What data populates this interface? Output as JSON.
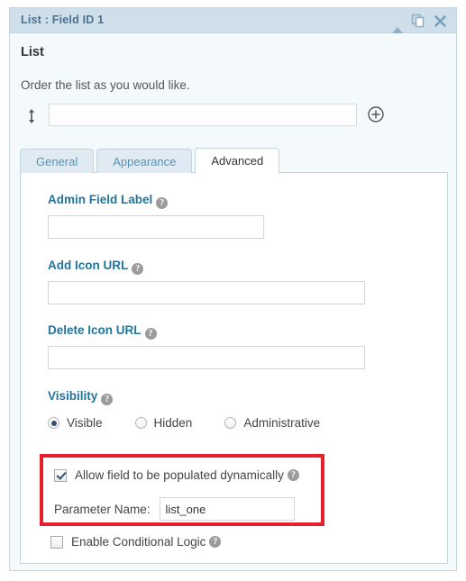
{
  "panel": {
    "title": "List : Field ID 1",
    "header_icons": [
      {
        "name": "collapse-icon",
        "glyph": "▲"
      },
      {
        "name": "duplicate-icon",
        "glyph": "❐"
      },
      {
        "name": "close-icon",
        "glyph": "✕"
      }
    ]
  },
  "field": {
    "name": "List",
    "instruction": "Order the list as you would like.",
    "list_item_value": "",
    "list_item_placeholder": "",
    "drag_handle_icon": "drag-vertical-icon",
    "add_row_icon": "plus-circle-icon"
  },
  "tabs": [
    {
      "label": "General",
      "active": false
    },
    {
      "label": "Appearance",
      "active": false
    },
    {
      "label": "Advanced",
      "active": true
    }
  ],
  "advanced": {
    "admin_field_label": {
      "label": "Admin Field Label",
      "help": "?",
      "value": ""
    },
    "add_icon_url": {
      "label": "Add Icon URL",
      "help": "?",
      "value": ""
    },
    "delete_icon_url": {
      "label": "Delete Icon URL",
      "help": "?",
      "value": ""
    },
    "visibility": {
      "label": "Visibility",
      "help": "?",
      "options": [
        {
          "label": "Visible",
          "selected": true
        },
        {
          "label": "Hidden",
          "selected": false
        },
        {
          "label": "Administrative",
          "selected": false
        }
      ]
    },
    "dynamic_population": {
      "checkbox_label": "Allow field to be populated dynamically",
      "help": "?",
      "checked": true,
      "parameter_name_label": "Parameter Name:",
      "parameter_name_value": "list_one",
      "highlight_color": "#e8202a"
    },
    "conditional_logic": {
      "checkbox_label": "Enable Conditional Logic",
      "help": "?",
      "checked": false
    }
  },
  "colors": {
    "header_bg": "#cfdfea",
    "header_text": "#4a7294",
    "panel_bg": "#f4f9fc",
    "panel_border": "#c3d6e0",
    "label_blue": "#21759b",
    "tab_inactive_bg": "#dfeaf2",
    "tab_inactive_text": "#5892b5",
    "highlight_red": "#e8202a"
  }
}
